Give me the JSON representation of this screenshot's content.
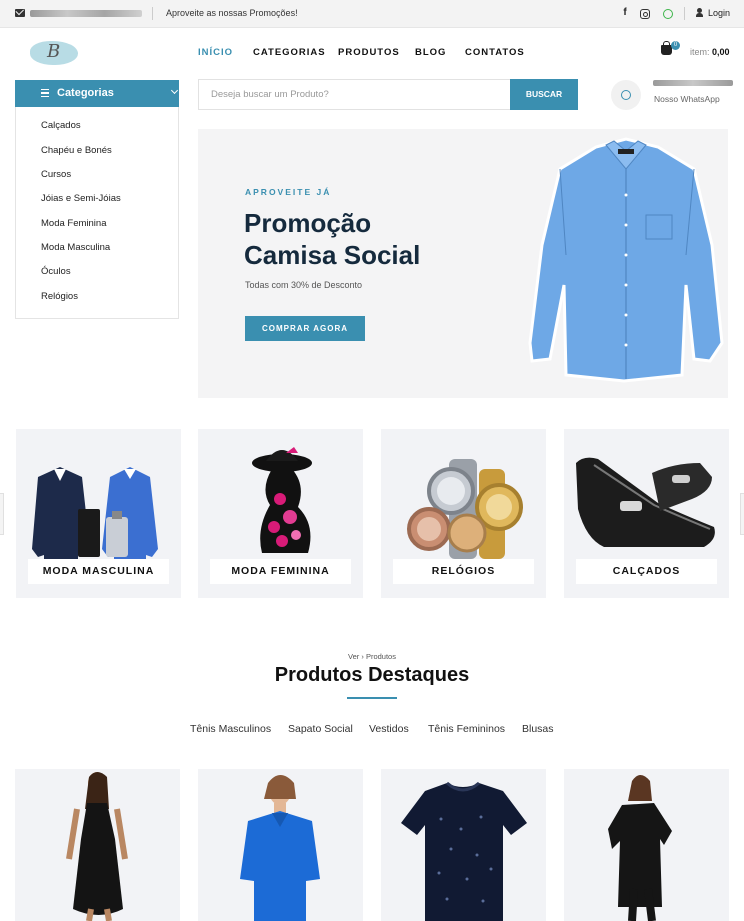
{
  "topbar": {
    "promo_text": "Aproveite as nossas Promoções!",
    "login_label": "Login",
    "icons": [
      "mail-icon",
      "facebook-icon",
      "instagram-icon",
      "whatsapp-icon",
      "user-icon"
    ]
  },
  "header": {
    "logo_letter": "B",
    "nav": [
      "INÍCIO",
      "CATEGORIAS",
      "PRODUTOS",
      "BLOG",
      "CONTATOS"
    ],
    "cart": {
      "badge": "0",
      "label": "item:",
      "total": "0,00"
    }
  },
  "categories": {
    "title": "Categorias",
    "items": [
      "Calçados",
      "Chapéu e Bonés",
      "Cursos",
      "Jóias e Semi-Jóias",
      "Moda Feminina",
      "Moda Masculina",
      "Óculos",
      "Relógios"
    ]
  },
  "search": {
    "placeholder": "Deseja buscar um Produto?",
    "button": "BUSCAR"
  },
  "whatsapp": {
    "label": "Nosso WhatsApp"
  },
  "hero": {
    "kicker": "APROVEITE JÁ",
    "title_line1": "Promoção",
    "title_line2": "Camisa Social",
    "subtitle": "Todas com 30% de Desconto",
    "button": "COMPRAR AGORA"
  },
  "category_cards": [
    "MODA MASCULINA",
    "MODA FEMININA",
    "RELÓGIOS",
    "CALÇADOS"
  ],
  "featured": {
    "crumb": "Ver › Produtos",
    "title": "Produtos Destaques",
    "tabs": [
      "Tênis Masculinos",
      "Sapato Social",
      "Vestidos",
      "Tênis Femininos",
      "Blusas"
    ]
  },
  "colors": {
    "accent": "#3a8fb0",
    "dark": "#152a3d"
  }
}
